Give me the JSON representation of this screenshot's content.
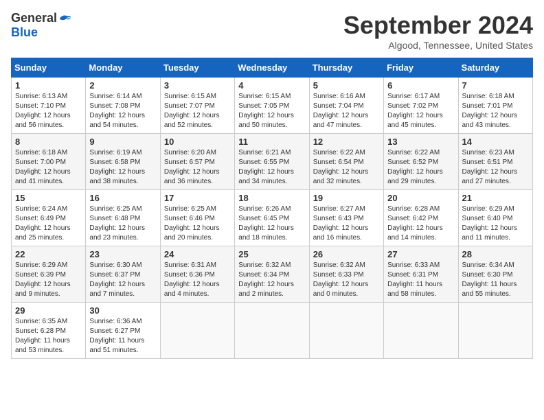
{
  "header": {
    "logo_general": "General",
    "logo_blue": "Blue",
    "month_title": "September 2024",
    "location": "Algood, Tennessee, United States"
  },
  "days_of_week": [
    "Sunday",
    "Monday",
    "Tuesday",
    "Wednesday",
    "Thursday",
    "Friday",
    "Saturday"
  ],
  "weeks": [
    [
      {
        "day": "1",
        "info": "Sunrise: 6:13 AM\nSunset: 7:10 PM\nDaylight: 12 hours\nand 56 minutes."
      },
      {
        "day": "2",
        "info": "Sunrise: 6:14 AM\nSunset: 7:08 PM\nDaylight: 12 hours\nand 54 minutes."
      },
      {
        "day": "3",
        "info": "Sunrise: 6:15 AM\nSunset: 7:07 PM\nDaylight: 12 hours\nand 52 minutes."
      },
      {
        "day": "4",
        "info": "Sunrise: 6:15 AM\nSunset: 7:05 PM\nDaylight: 12 hours\nand 50 minutes."
      },
      {
        "day": "5",
        "info": "Sunrise: 6:16 AM\nSunset: 7:04 PM\nDaylight: 12 hours\nand 47 minutes."
      },
      {
        "day": "6",
        "info": "Sunrise: 6:17 AM\nSunset: 7:02 PM\nDaylight: 12 hours\nand 45 minutes."
      },
      {
        "day": "7",
        "info": "Sunrise: 6:18 AM\nSunset: 7:01 PM\nDaylight: 12 hours\nand 43 minutes."
      }
    ],
    [
      {
        "day": "8",
        "info": "Sunrise: 6:18 AM\nSunset: 7:00 PM\nDaylight: 12 hours\nand 41 minutes."
      },
      {
        "day": "9",
        "info": "Sunrise: 6:19 AM\nSunset: 6:58 PM\nDaylight: 12 hours\nand 38 minutes."
      },
      {
        "day": "10",
        "info": "Sunrise: 6:20 AM\nSunset: 6:57 PM\nDaylight: 12 hours\nand 36 minutes."
      },
      {
        "day": "11",
        "info": "Sunrise: 6:21 AM\nSunset: 6:55 PM\nDaylight: 12 hours\nand 34 minutes."
      },
      {
        "day": "12",
        "info": "Sunrise: 6:22 AM\nSunset: 6:54 PM\nDaylight: 12 hours\nand 32 minutes."
      },
      {
        "day": "13",
        "info": "Sunrise: 6:22 AM\nSunset: 6:52 PM\nDaylight: 12 hours\nand 29 minutes."
      },
      {
        "day": "14",
        "info": "Sunrise: 6:23 AM\nSunset: 6:51 PM\nDaylight: 12 hours\nand 27 minutes."
      }
    ],
    [
      {
        "day": "15",
        "info": "Sunrise: 6:24 AM\nSunset: 6:49 PM\nDaylight: 12 hours\nand 25 minutes."
      },
      {
        "day": "16",
        "info": "Sunrise: 6:25 AM\nSunset: 6:48 PM\nDaylight: 12 hours\nand 23 minutes."
      },
      {
        "day": "17",
        "info": "Sunrise: 6:25 AM\nSunset: 6:46 PM\nDaylight: 12 hours\nand 20 minutes."
      },
      {
        "day": "18",
        "info": "Sunrise: 6:26 AM\nSunset: 6:45 PM\nDaylight: 12 hours\nand 18 minutes."
      },
      {
        "day": "19",
        "info": "Sunrise: 6:27 AM\nSunset: 6:43 PM\nDaylight: 12 hours\nand 16 minutes."
      },
      {
        "day": "20",
        "info": "Sunrise: 6:28 AM\nSunset: 6:42 PM\nDaylight: 12 hours\nand 14 minutes."
      },
      {
        "day": "21",
        "info": "Sunrise: 6:29 AM\nSunset: 6:40 PM\nDaylight: 12 hours\nand 11 minutes."
      }
    ],
    [
      {
        "day": "22",
        "info": "Sunrise: 6:29 AM\nSunset: 6:39 PM\nDaylight: 12 hours\nand 9 minutes."
      },
      {
        "day": "23",
        "info": "Sunrise: 6:30 AM\nSunset: 6:37 PM\nDaylight: 12 hours\nand 7 minutes."
      },
      {
        "day": "24",
        "info": "Sunrise: 6:31 AM\nSunset: 6:36 PM\nDaylight: 12 hours\nand 4 minutes."
      },
      {
        "day": "25",
        "info": "Sunrise: 6:32 AM\nSunset: 6:34 PM\nDaylight: 12 hours\nand 2 minutes."
      },
      {
        "day": "26",
        "info": "Sunrise: 6:32 AM\nSunset: 6:33 PM\nDaylight: 12 hours\nand 0 minutes."
      },
      {
        "day": "27",
        "info": "Sunrise: 6:33 AM\nSunset: 6:31 PM\nDaylight: 11 hours\nand 58 minutes."
      },
      {
        "day": "28",
        "info": "Sunrise: 6:34 AM\nSunset: 6:30 PM\nDaylight: 11 hours\nand 55 minutes."
      }
    ],
    [
      {
        "day": "29",
        "info": "Sunrise: 6:35 AM\nSunset: 6:28 PM\nDaylight: 11 hours\nand 53 minutes."
      },
      {
        "day": "30",
        "info": "Sunrise: 6:36 AM\nSunset: 6:27 PM\nDaylight: 11 hours\nand 51 minutes."
      },
      {
        "day": "",
        "info": ""
      },
      {
        "day": "",
        "info": ""
      },
      {
        "day": "",
        "info": ""
      },
      {
        "day": "",
        "info": ""
      },
      {
        "day": "",
        "info": ""
      }
    ]
  ]
}
